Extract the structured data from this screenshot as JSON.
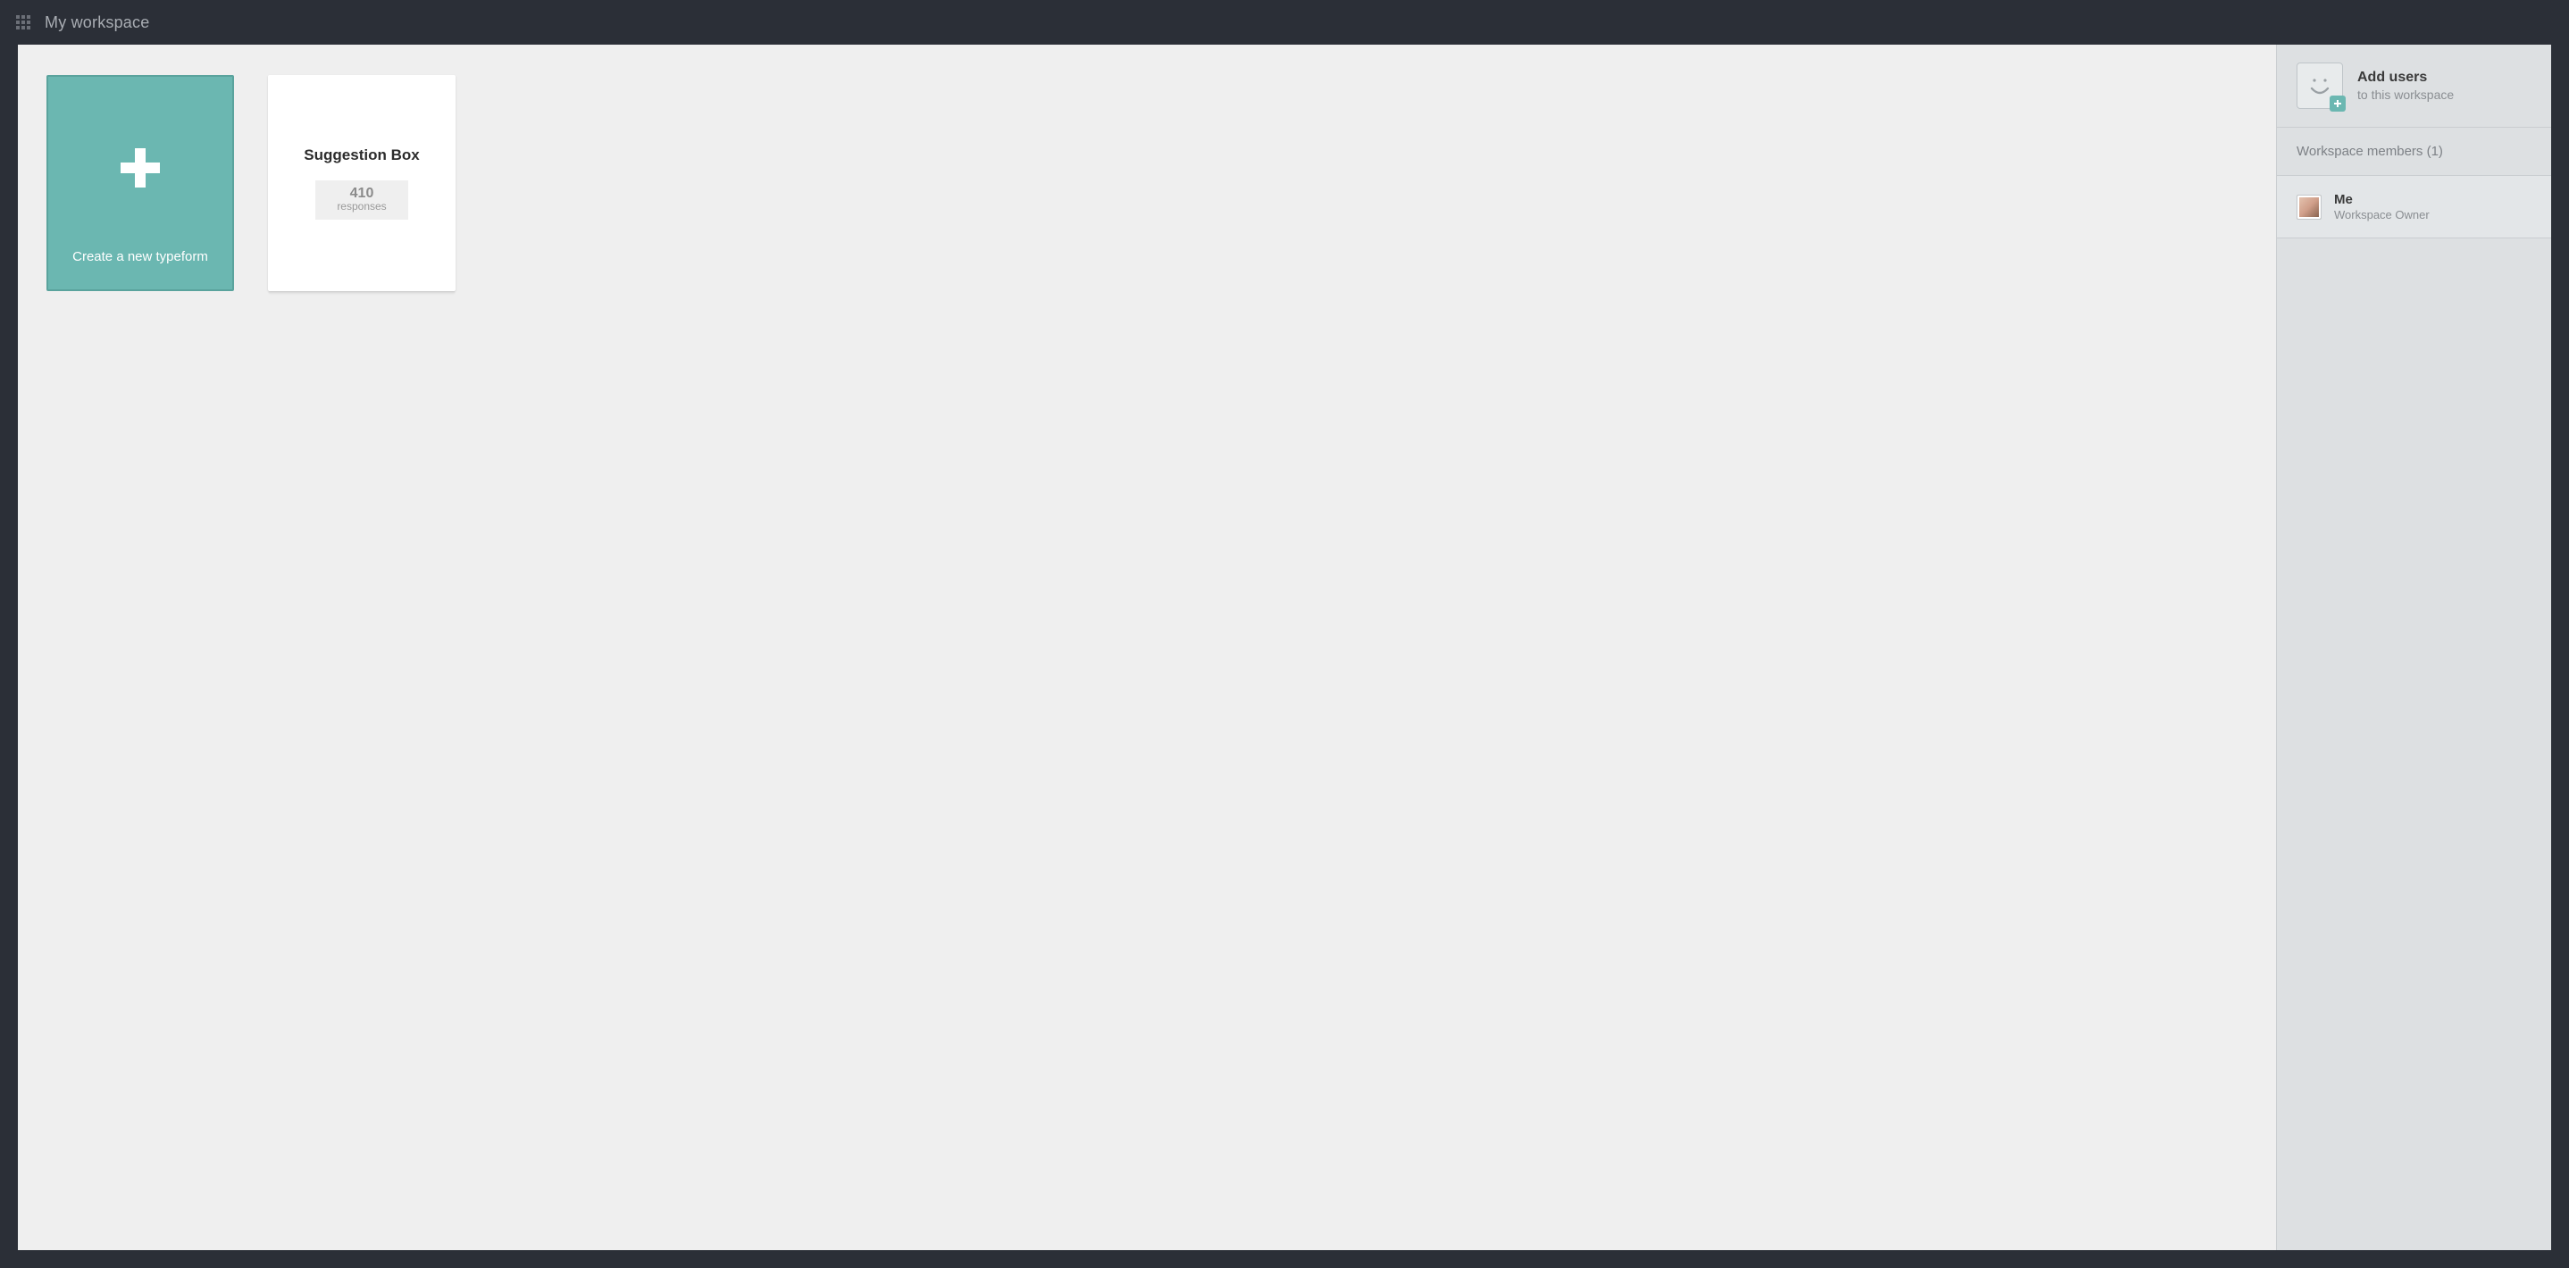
{
  "header": {
    "title": "My workspace"
  },
  "main": {
    "create_card": {
      "label": "Create a new typeform"
    },
    "forms": [
      {
        "title": "Suggestion Box",
        "response_count": "410",
        "response_label": "responses"
      }
    ]
  },
  "sidebar": {
    "add_users": {
      "title": "Add users",
      "subtitle": "to this workspace"
    },
    "members_header": "Workspace members (1)",
    "members": [
      {
        "name": "Me",
        "role": "Workspace Owner"
      }
    ]
  },
  "colors": {
    "accent": "#6bb7b1",
    "topbar": "#2b2f37",
    "panel": "#efefef",
    "sidebar": "#dde0e2"
  }
}
